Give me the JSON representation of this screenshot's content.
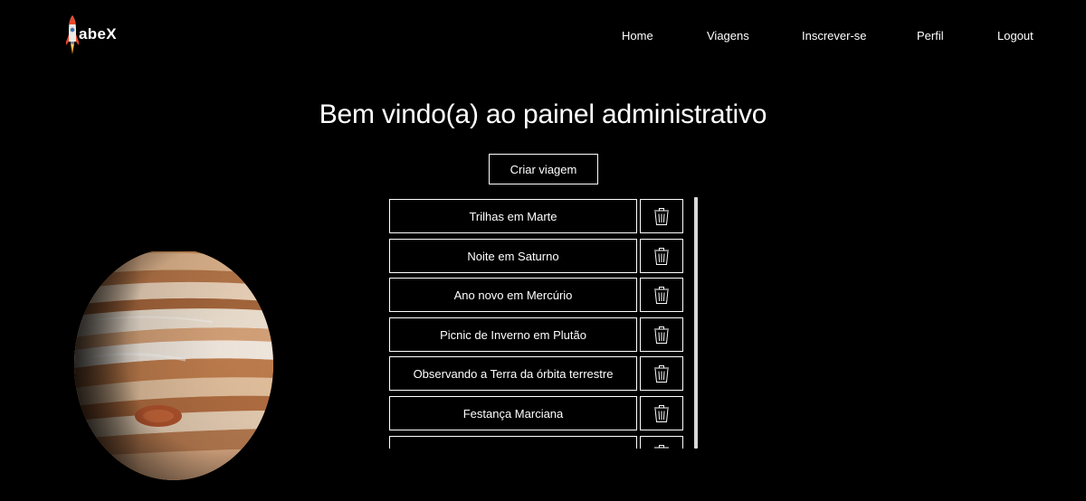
{
  "header": {
    "logo_text": "abeX",
    "nav": [
      {
        "label": "Home"
      },
      {
        "label": "Viagens"
      },
      {
        "label": "Inscrever-se"
      },
      {
        "label": "Perfil"
      },
      {
        "label": "Logout"
      }
    ]
  },
  "main": {
    "title": "Bem vindo(a) ao painel administrativo",
    "create_button": "Criar viagem",
    "trips": [
      {
        "name": "Trilhas em Marte"
      },
      {
        "name": "Noite em Saturno"
      },
      {
        "name": "Ano novo em Mercúrio"
      },
      {
        "name": "Picnic de Inverno em Plutão"
      },
      {
        "name": "Observando a Terra da órbita terrestre"
      },
      {
        "name": "Festança Marciana"
      },
      {
        "name": ""
      }
    ]
  },
  "icons": {
    "logo": "rocket-icon",
    "delete": "trash-icon",
    "background": "jupiter-planet"
  },
  "colors": {
    "background": "#000000",
    "foreground": "#ffffff",
    "rocket_flame": "#e8472b"
  }
}
